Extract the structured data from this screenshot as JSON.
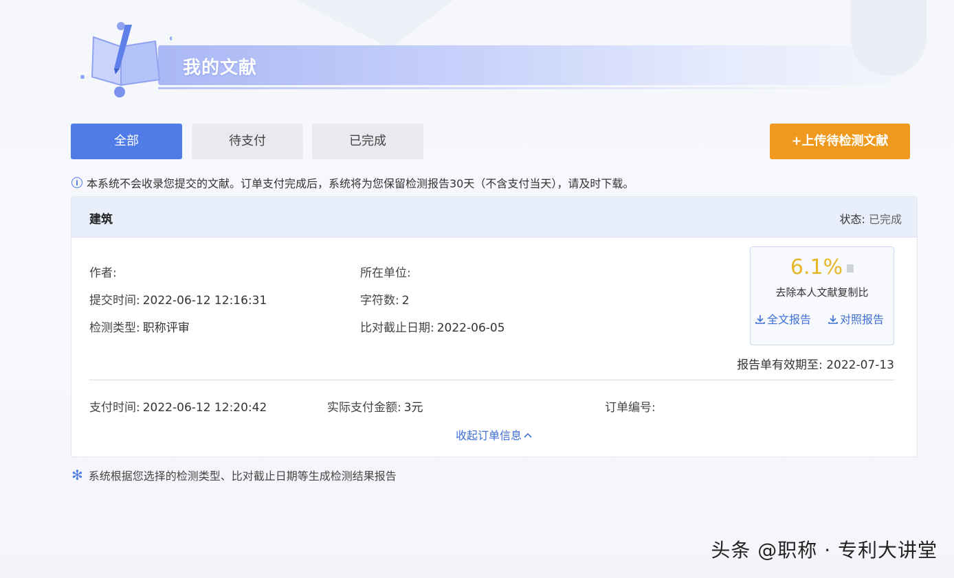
{
  "header": {
    "title": "我的文献"
  },
  "tabs": [
    {
      "label": "全部",
      "active": true
    },
    {
      "label": "待支付",
      "active": false
    },
    {
      "label": "已完成",
      "active": false
    }
  ],
  "upload_button": {
    "label": "+上传待检测文献"
  },
  "notice": {
    "icon": "info-icon",
    "text": "本系统不会收录您提交的文献。订单支付完成后，系统将为您保留检测报告30天（不含支付当天），请及时下载。"
  },
  "record": {
    "title": "建筑",
    "status_label": "状态:",
    "status_value": "已完成",
    "author_label": "作者:",
    "author_value": "",
    "org_label": "所在单位:",
    "org_value": "",
    "submit_time_label": "提交时间:",
    "submit_time_value": "2022-06-12 12:16:31",
    "char_count_label": "字符数:",
    "char_count_value": "2",
    "check_type_label": "检测类型:",
    "check_type_value": "职称评审",
    "cutoff_label": "比对截止日期:",
    "cutoff_value": "2022-06-05",
    "similarity": "6.1%",
    "similarity_label": "去除本人文献复制比",
    "full_report_label": "全文报告",
    "compare_report_label": "对照报告",
    "valid_until_label": "报告单有效期至:",
    "valid_until_value": "2022-07-13",
    "pay_time_label": "支付时间:",
    "pay_time_value": "2022-06-12 12:20:42",
    "amount_label": "实际支付金额:",
    "amount_value": "3元",
    "order_no_label": "订单编号:",
    "order_no_value": "",
    "collapse_label": "收起订单信息"
  },
  "footnote": {
    "icon": "asterisk-icon",
    "text": "系统根据您选择的检测类型、比对截止日期等生成检测结果报告"
  },
  "watermark": "头条 @职称 · 专利大讲堂",
  "colors": {
    "primary": "#4f7ce6",
    "upload": "#ef9a1f",
    "similarity": "#e6b626",
    "link": "#3d6fd6"
  }
}
